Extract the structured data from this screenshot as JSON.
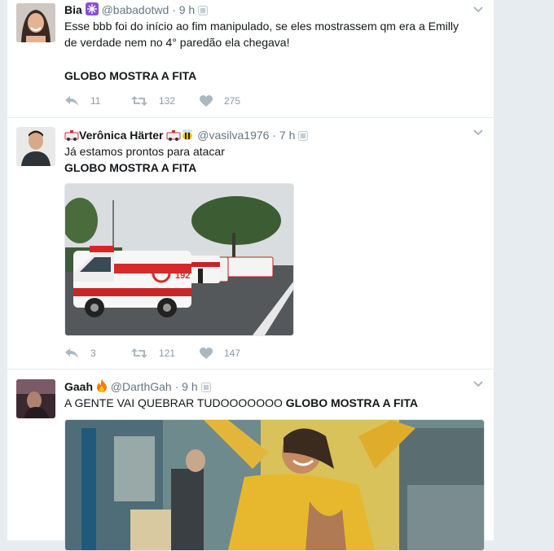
{
  "tweets": [
    {
      "name": "Bia",
      "handle": "@babadotwd",
      "dot": "·",
      "time": "9 h",
      "text_line1": "Esse bbb foi do início ao fim manipulado, se eles mostrassem qm era a Emilly",
      "text_line2": "de verdade nem no 4° paredão ela chegava!",
      "text_bold": "GLOBO MOSTRA A FITA",
      "replies": "11",
      "retweets": "132",
      "likes": "275"
    },
    {
      "name": "Verônica Härter",
      "handle": "@vasilva1976",
      "dot": "·",
      "time": "7 h",
      "text_line1": "Já estamos prontos para atacar",
      "text_bold": "GLOBO MOSTRA A FITA",
      "ambulance_number": "192",
      "replies": "3",
      "retweets": "121",
      "likes": "147"
    },
    {
      "name": "Gaah",
      "handle": "@DarthGah",
      "dot": "·",
      "time": "9 h",
      "text_plain": "A GENTE VAI QUEBRAR TUDOOOOOOO",
      "text_bold": "GLOBO MOSTRA A FITA"
    }
  ],
  "colors": {
    "timeline_bg": "#e6ecf0",
    "action_gray": "#8899a6",
    "handle_gray": "#657786"
  }
}
